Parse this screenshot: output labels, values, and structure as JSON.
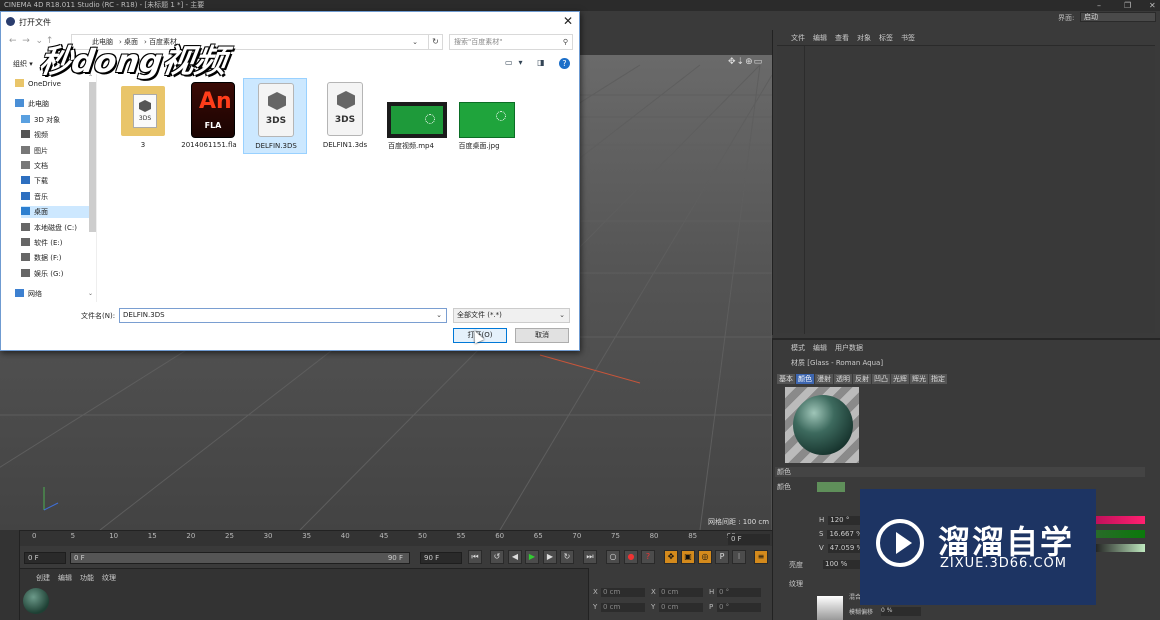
{
  "app": {
    "title": "CINEMA 4D R18.011 Studio (RC - R18) - [未标题 1 *] - 主要",
    "layout_label": "界面:",
    "layout_value": "启动"
  },
  "watermarks": {
    "miaodong": "秒dong视频",
    "zixue_cn": "溜溜自学",
    "zixue_url": "ZIXUE.3D66.COM"
  },
  "dialog": {
    "title": "打开文件",
    "close": "✕",
    "breadcrumb": [
      "此电脑",
      "桌面",
      "百度素材"
    ],
    "search_placeholder": "搜索\"百度素材\"",
    "organize": "组织 ▾",
    "sidebar": [
      {
        "label": "OneDrive",
        "icon": "folder-icon",
        "selected": false,
        "sub": false
      },
      {
        "label": "此电脑",
        "icon": "computer-icon",
        "selected": false,
        "sub": false
      },
      {
        "label": "3D 对象",
        "icon": "3d-objects-icon",
        "selected": false,
        "sub": true
      },
      {
        "label": "视频",
        "icon": "video-folder-icon",
        "selected": false,
        "sub": true
      },
      {
        "label": "图片",
        "icon": "pictures-icon",
        "selected": false,
        "sub": true
      },
      {
        "label": "文档",
        "icon": "documents-icon",
        "selected": false,
        "sub": true
      },
      {
        "label": "下载",
        "icon": "download-icon",
        "selected": false,
        "sub": true
      },
      {
        "label": "音乐",
        "icon": "music-icon",
        "selected": false,
        "sub": true
      },
      {
        "label": "桌面",
        "icon": "desktop-icon",
        "selected": true,
        "sub": true
      },
      {
        "label": "本地磁盘 (C:)",
        "icon": "drive-icon",
        "selected": false,
        "sub": true
      },
      {
        "label": "软件 (E:)",
        "icon": "drive-icon",
        "selected": false,
        "sub": true
      },
      {
        "label": "数据 (F:)",
        "icon": "drive-icon",
        "selected": false,
        "sub": true
      },
      {
        "label": "娱乐 (G:)",
        "icon": "drive-icon",
        "selected": false,
        "sub": true
      },
      {
        "label": "网络",
        "icon": "network-icon",
        "selected": false,
        "sub": false
      }
    ],
    "files": [
      {
        "name": "3",
        "kind": "folder",
        "badge": "3DS"
      },
      {
        "name": "2014061151.fla",
        "kind": "animate",
        "badge": "An",
        "badge2": "FLA"
      },
      {
        "name": "DELFIN.3DS",
        "kind": "3ds",
        "badge": "3DS",
        "selected": true
      },
      {
        "name": "DELFIN1.3ds",
        "kind": "3ds",
        "badge": "3DS"
      },
      {
        "name": "百度视频.mp4",
        "kind": "video"
      },
      {
        "name": "百度桌面.jpg",
        "kind": "image"
      }
    ],
    "filename_label": "文件名(N):",
    "filename_value": "DELFIN.3DS",
    "filter_value": "全部文件 (*.*)",
    "open_label": "打开(O)",
    "cancel_label": "取消"
  },
  "viewport": {
    "grid_spacing": "网格间距 : 100 cm"
  },
  "timeline": {
    "ticks": [
      "0",
      "5",
      "10",
      "15",
      "20",
      "25",
      "30",
      "35",
      "40",
      "45",
      "50",
      "55",
      "60",
      "65",
      "70",
      "75",
      "80",
      "85",
      "90"
    ],
    "current_frame": "0 F",
    "start": "0 F",
    "range_start": "0 F",
    "range_end": "90 F",
    "end": "90 F"
  },
  "material_manager": {
    "menu": [
      "创建",
      "编辑",
      "功能",
      "纹理"
    ]
  },
  "coordinates": {
    "rows": [
      {
        "a": "X",
        "av": "0 cm",
        "b": "X",
        "bv": "0 cm",
        "c": "H",
        "cv": "0 °"
      },
      {
        "a": "Y",
        "av": "0 cm",
        "b": "Y",
        "bv": "0 cm",
        "c": "P",
        "cv": "0 °"
      }
    ]
  },
  "object_manager": {
    "menu": [
      "文件",
      "编辑",
      "查看",
      "对象",
      "标签",
      "书签"
    ]
  },
  "attributes": {
    "menu": [
      "模式",
      "编辑",
      "用户数据"
    ],
    "material_name": "材质 [Glass - Roman Aqua]",
    "tabs": [
      "基本",
      "颜色",
      "漫射",
      "透明",
      "反射",
      "凹凸",
      "光辉",
      "辉光",
      "指定"
    ],
    "active_tab": "颜色",
    "section": "颜色",
    "color_label": "颜色",
    "h": "120 °",
    "s": "16.667 %",
    "v": "47.059 %",
    "brightness_label": "亮度",
    "brightness": "100 %",
    "texture_label": "纹理",
    "mix_label": "混合",
    "blur_label": "模糊偏移",
    "blur": "0 %"
  }
}
